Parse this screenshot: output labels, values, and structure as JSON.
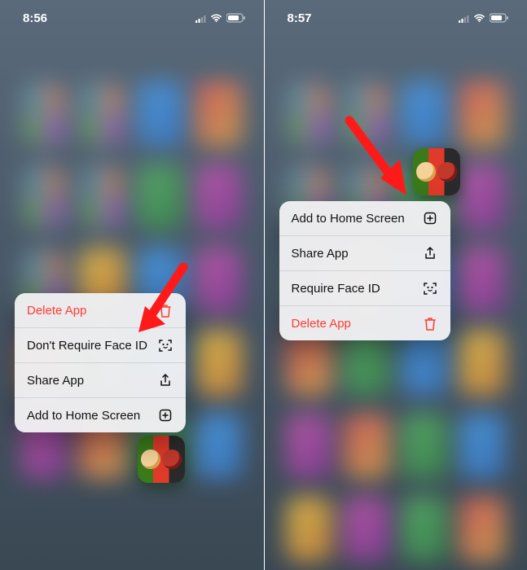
{
  "left": {
    "time": "8:56",
    "menu": [
      {
        "name": "delete-app",
        "label": "Delete App",
        "icon": "trash",
        "destructive": true
      },
      {
        "name": "dont-require-faceid",
        "label": "Don't Require Face ID",
        "icon": "faceid",
        "destructive": false
      },
      {
        "name": "share-app",
        "label": "Share App",
        "icon": "share",
        "destructive": false
      },
      {
        "name": "add-home",
        "label": "Add to Home Screen",
        "icon": "addbox",
        "destructive": false
      }
    ],
    "app_name": "game-app-icon"
  },
  "right": {
    "time": "8:57",
    "menu": [
      {
        "name": "add-home",
        "label": "Add to Home Screen",
        "icon": "addbox",
        "destructive": false
      },
      {
        "name": "share-app",
        "label": "Share App",
        "icon": "share",
        "destructive": false
      },
      {
        "name": "require-faceid",
        "label": "Require Face ID",
        "icon": "faceid",
        "destructive": false
      },
      {
        "name": "delete-app",
        "label": "Delete App",
        "icon": "trash",
        "destructive": true
      }
    ],
    "app_name": "game-app-icon"
  }
}
